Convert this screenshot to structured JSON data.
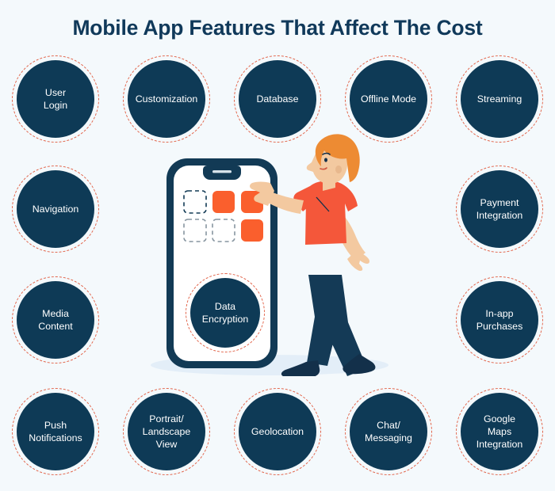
{
  "header": {
    "title": "Mobile App Features That Affect The Cost"
  },
  "palette": {
    "background": "#f4f9fc",
    "navy": "#0e3a56",
    "navy_dark": "#123a55",
    "coral_dashed": "#e2654b",
    "orange": "#fa5f2d",
    "skin": "#f3c9a0",
    "hair": "#ed8b33",
    "shirt": "#f4573a",
    "shadow": "#e3eef8",
    "white": "#ffffff"
  },
  "features": {
    "top_row": [
      {
        "label": "User\nLogin",
        "icon": "user-login"
      },
      {
        "label": "Customization",
        "icon": "customization"
      },
      {
        "label": "Database",
        "icon": "database"
      },
      {
        "label": "Offline Mode",
        "icon": "offline-mode"
      },
      {
        "label": "Streaming",
        "icon": "streaming"
      }
    ],
    "left_column": [
      {
        "label": "Navigation",
        "icon": "navigation"
      },
      {
        "label": "Media\nContent",
        "icon": "media-content"
      }
    ],
    "right_column": [
      {
        "label": "Payment\nIntegration",
        "icon": "payment-integration"
      },
      {
        "label": "In-app\nPurchases",
        "icon": "in-app-purchases"
      }
    ],
    "bottom_row": [
      {
        "label": "Push\nNotifications",
        "icon": "push-notifications"
      },
      {
        "label": "Portrait/\nLandscape\nView",
        "icon": "portrait-landscape-view"
      },
      {
        "label": "Geolocation",
        "icon": "geolocation"
      },
      {
        "label": "Chat/\nMessaging",
        "icon": "chat-messaging"
      },
      {
        "label": "Google\nMaps\nIntegration",
        "icon": "google-maps-integration"
      }
    ],
    "center": {
      "label": "Data\nEncryption",
      "icon": "data-encryption"
    }
  },
  "illustration": {
    "name": "woman-pointing-at-smartphone",
    "phone": {
      "name": "smartphone-mockup",
      "app_grid": [
        {
          "slot": "r1c1",
          "state": "empty-dashed"
        },
        {
          "slot": "r1c2",
          "state": "filled-orange"
        },
        {
          "slot": "r1c3",
          "state": "filled-orange"
        },
        {
          "slot": "r2c1",
          "state": "empty-dashed"
        },
        {
          "slot": "r2c2",
          "state": "empty-dashed"
        },
        {
          "slot": "r2c3",
          "state": "filled-orange"
        }
      ]
    },
    "person": {
      "name": "woman-character",
      "hair": "orange-bob",
      "top": "orange-tshirt",
      "bottom": "navy-trousers",
      "shoes": "navy-flats"
    }
  }
}
